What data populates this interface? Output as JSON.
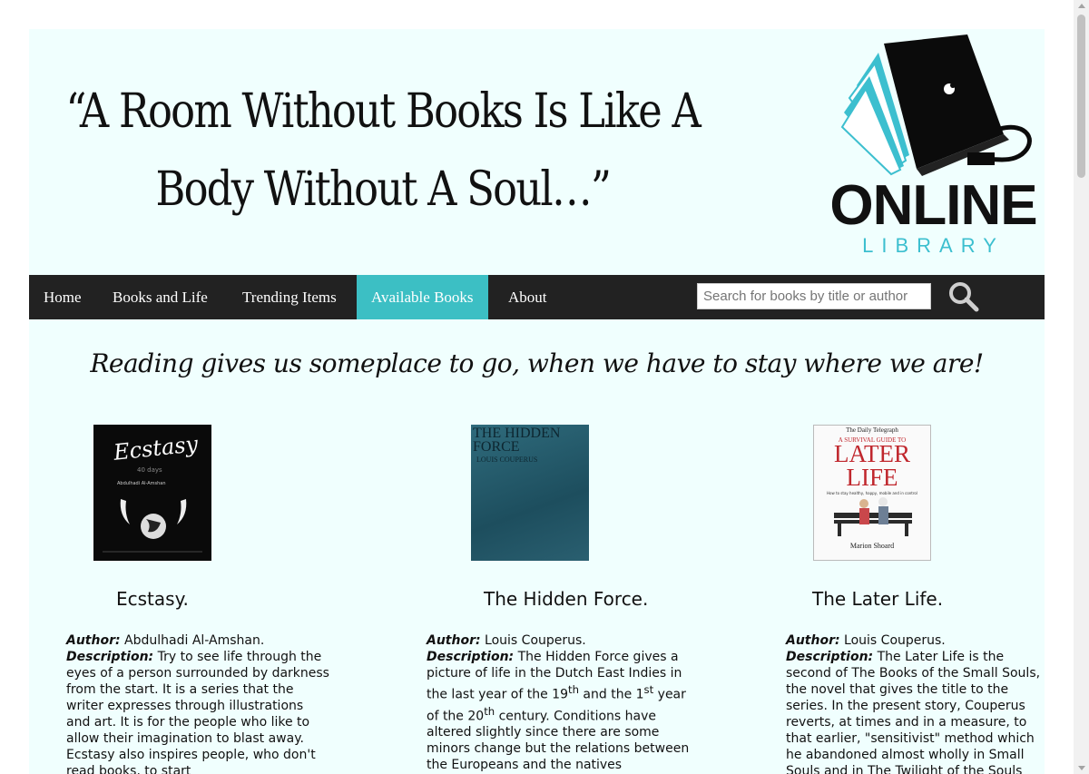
{
  "header": {
    "quote_line1": "“A Room Without Books Is Like A",
    "quote_line2": "Body Without A Soul…”",
    "logo_word": "ONLINE",
    "logo_sub": "LIBRARY"
  },
  "nav": {
    "items": [
      {
        "label": "Home"
      },
      {
        "label": "Books and Life"
      },
      {
        "label": "Trending Items"
      },
      {
        "label": "Available Books"
      },
      {
        "label": "About"
      }
    ],
    "active": "Available Books",
    "search_placeholder": "Search for books by title or author",
    "search_icon": "search-icon"
  },
  "tagline": "Reading gives us someplace to go, when we have to stay where we are!",
  "books": [
    {
      "cover_title": "Ecstasy",
      "cover_sub": "40 days",
      "cover_author": "Abdulhadi Al-Amshan",
      "title": "Ecstasy.",
      "author_label": "Author:",
      "author": "Abdulhadi Al-Amshan.",
      "description_label": "Description:",
      "description": "Try to see life through the eyes of a person surrounded by darkness from the start. It is a series that the writer expresses through illustrations and art. It is for the people who like to allow their imagination to blast away. Ecstasy also inspires people, who don't read books, to start"
    },
    {
      "cover_title": "THE HIDDEN FORCE",
      "cover_author": "LOUIS COUPERUS",
      "title": "The Hidden Force.",
      "author_label": "Author:",
      "author": "Louis Couperus.",
      "description_label": "Description:",
      "description_a": "The Hidden Force gives a picture of life in the Dutch East Indies in the last year of the 19",
      "sup1": "th",
      "description_b": " and the 1",
      "sup2": "st",
      "description_c": " year of the 20",
      "sup3": "th",
      "description_d": " century. Conditions have altered slightly since there are some minors change but the relations between the Europeans and the natives"
    },
    {
      "cover_paper": "The Daily Telegraph",
      "cover_title_top": "A SURVIVAL GUIDE TO",
      "cover_title": "LATER LIFE",
      "cover_tagline": "How to stay healthy, happy, mobile and in control",
      "cover_author": "Marion Shoard",
      "title": "The Later Life.",
      "author_label": "Author:",
      "author": "Louis Couperus.",
      "description_label": "Description:",
      "description": "The Later Life is the second of The Books of the Small Souls, the novel that gives the title to the series. In the present story, Couperus reverts, at times and in a measure, to that earlier, \"sensitivist\" method which he abandoned almost wholly in Small Souls and in The Twilight of the Souls"
    }
  ],
  "colors": {
    "page_bg": "#f0fffe",
    "nav_bg": "#222222",
    "nav_active": "#3cbfc4",
    "logo_accent": "#3cbfcf"
  }
}
